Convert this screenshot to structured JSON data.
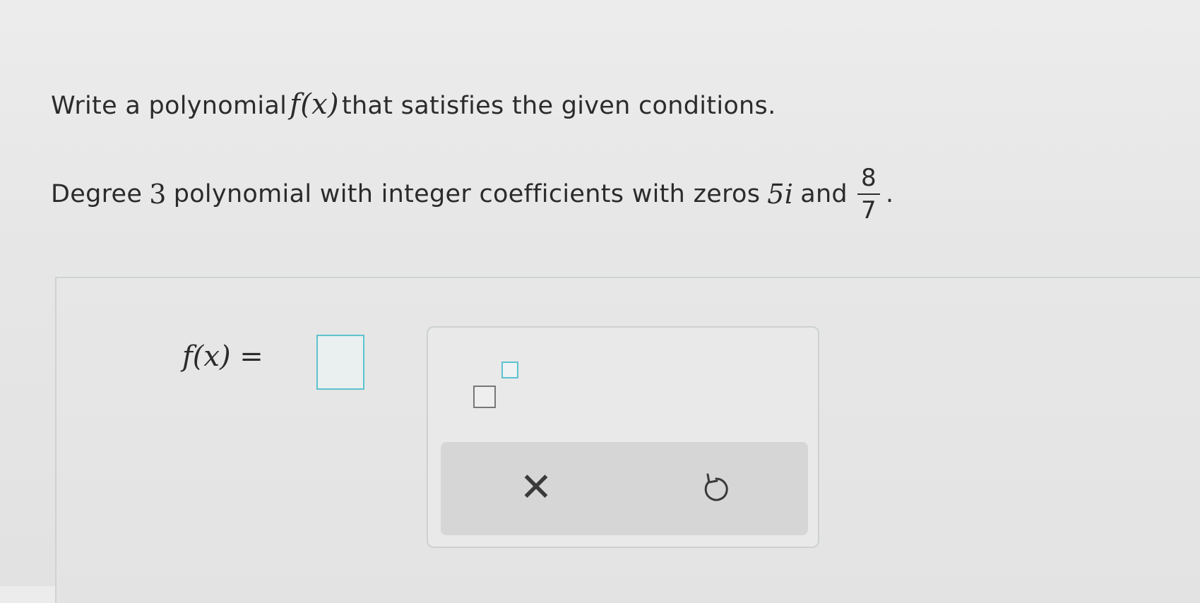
{
  "question": {
    "line1_before": "Write a polynomial",
    "line1_fx": "f(x)",
    "line1_after": "that satisfies the given conditions.",
    "line2_before": "Degree",
    "line2_degree": "3",
    "line2_middle": "polynomial with integer coefficients with zeros",
    "line2_zero1": "5i",
    "line2_and": "and",
    "fraction_numerator": "8",
    "fraction_denominator": "7",
    "line2_end": "."
  },
  "answer": {
    "label": "f(x) =",
    "value": ""
  },
  "toolbox": {
    "exponent_button": "superscript-template",
    "clear_symbol": "✕",
    "undo_icon": "undo-icon"
  },
  "colors": {
    "accent": "#5cc3cf",
    "text": "#2b2b2b",
    "action_bar": "#d6d6d6"
  }
}
